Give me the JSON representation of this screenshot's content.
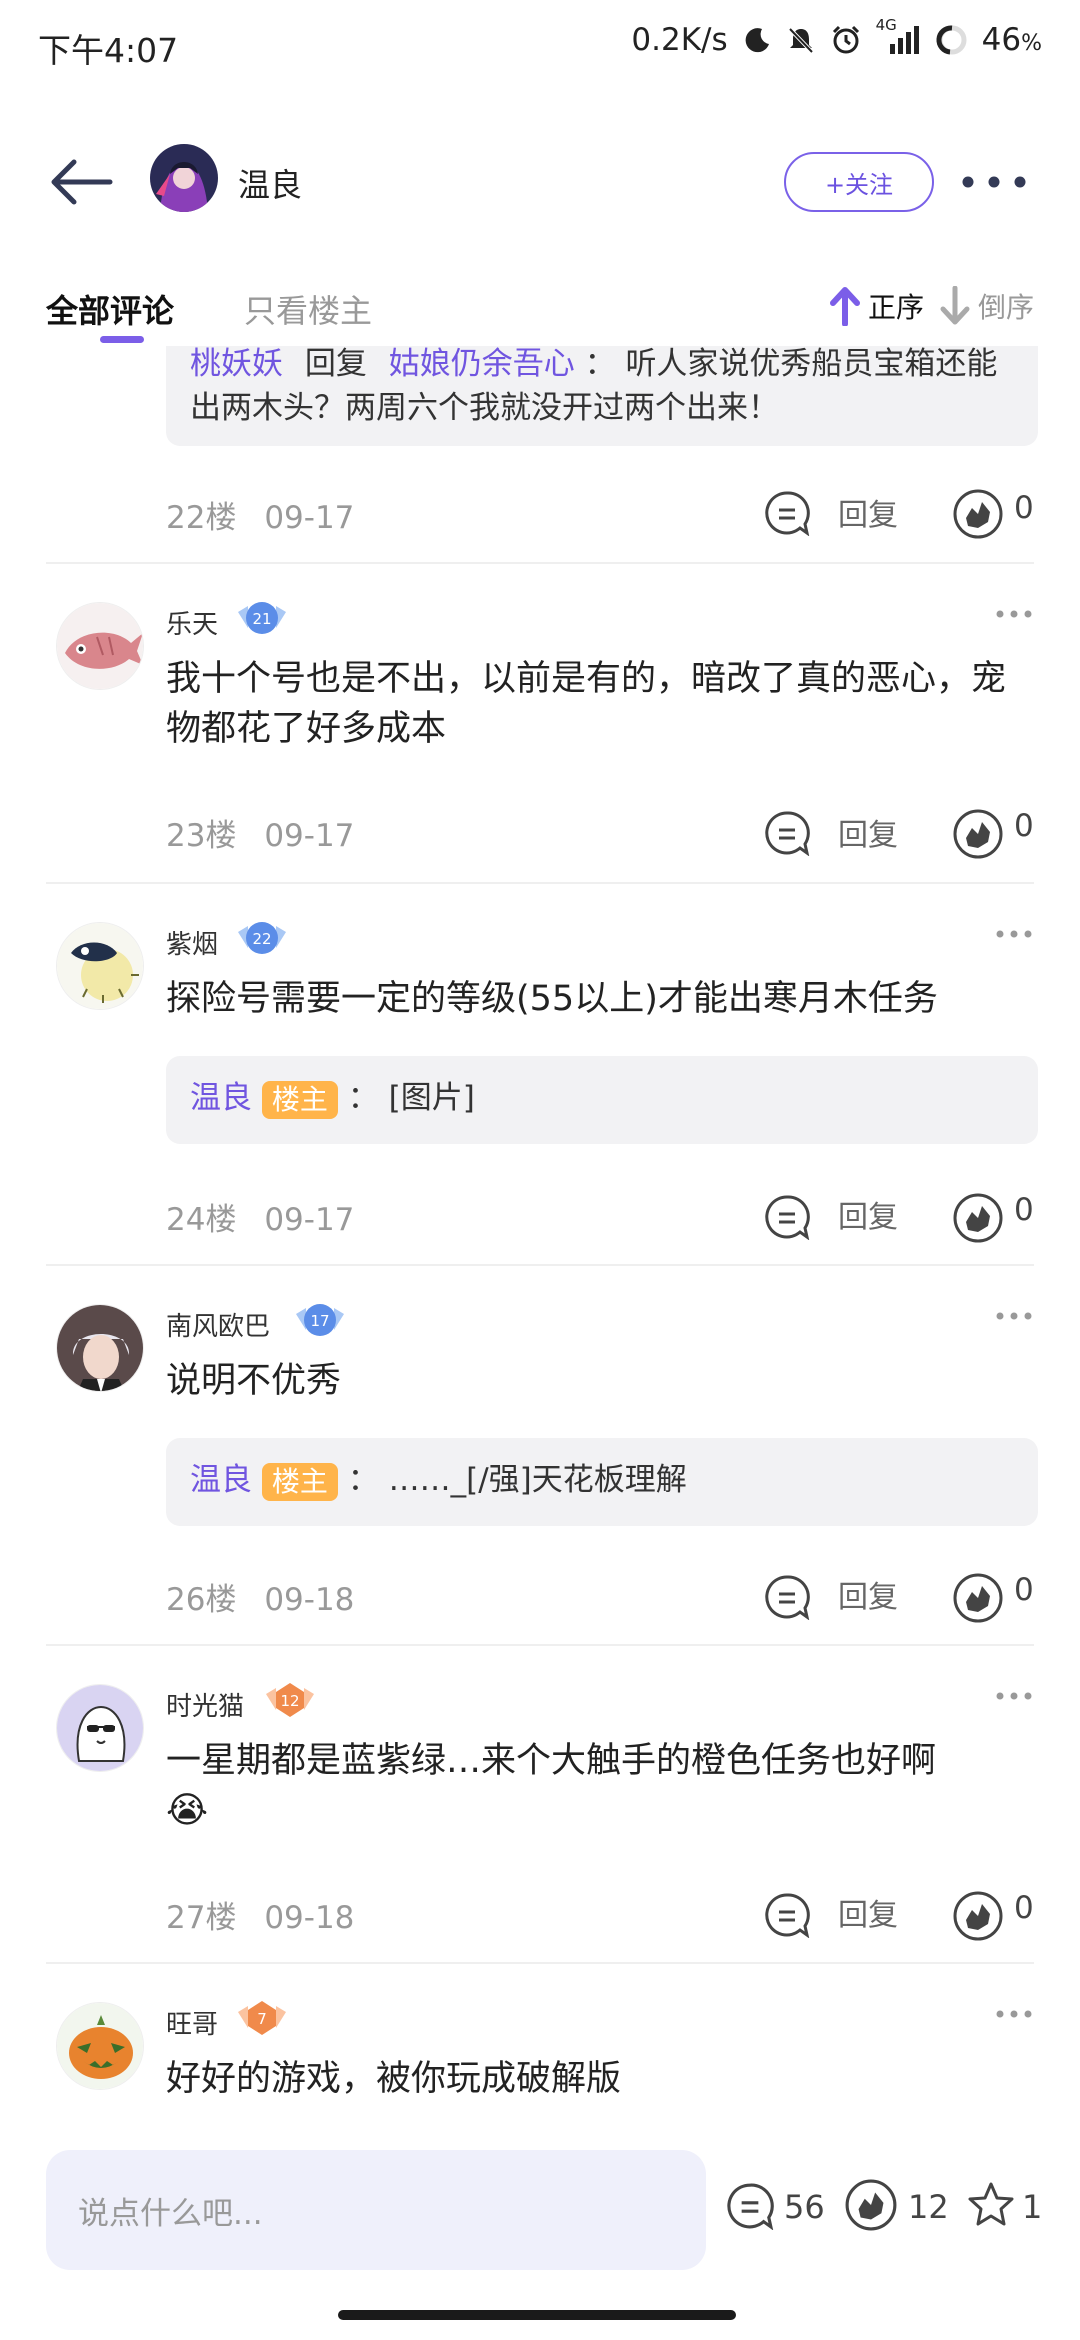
{
  "status_bar": {
    "time": "下午4:07",
    "speed": "0.2K/s",
    "network": "4G",
    "battery": "46"
  },
  "header": {
    "author_name": "温良",
    "follow_label": "+关注"
  },
  "tabs": {
    "all": "全部评论",
    "owner_only": "只看楼主",
    "sort_asc": "正序",
    "sort_desc": "倒序"
  },
  "thread": {
    "top_quote": {
      "user": "桃妖妖",
      "reply_word": "回复",
      "target": "姑娘仍余吾心",
      "text": "听人家说优秀船员宝箱还能出两木头？两周六个我就没开过两个出来！"
    },
    "top_meta": {
      "floor": "22楼",
      "date": "09-17",
      "reply_label": "回复",
      "likes": "0"
    },
    "comments": [
      {
        "user": "乐天",
        "level": "21",
        "text": "我十个号也是不出，以前是有的，暗改了真的恶心，宠物都花了好多成本",
        "floor": "23楼",
        "date": "09-17",
        "reply_label": "回复",
        "likes": "0"
      },
      {
        "user": "紫烟",
        "level": "22",
        "text": "探险号需要一定的等级(55以上)才能出寒月木任务",
        "quote": {
          "user": "温良",
          "tag": "楼主",
          "sep": "：",
          "text": "[图片]"
        },
        "floor": "24楼",
        "date": "09-17",
        "reply_label": "回复",
        "likes": "0"
      },
      {
        "user": "南风欧巴",
        "level": "17",
        "text": "说明不优秀",
        "quote": {
          "user": "温良",
          "tag": "楼主",
          "sep": "：",
          "text": "……_[/强]天花板理解"
        },
        "floor": "26楼",
        "date": "09-18",
        "reply_label": "回复",
        "likes": "0"
      },
      {
        "user": "时光猫",
        "level": "12",
        "text": "一星期都是蓝紫绿…来个大触手的橙色任务也好啊",
        "emoji": "😭",
        "floor": "27楼",
        "date": "09-18",
        "reply_label": "回复",
        "likes": "0"
      },
      {
        "user": "旺哥",
        "level": "7",
        "text": "好好的游戏，被你玩成破解版"
      }
    ]
  },
  "bottom_bar": {
    "placeholder": "说点什么吧...",
    "comment_count": "56",
    "like_count": "12",
    "star_count": "1"
  },
  "colors": {
    "accent": "#7b5ee8",
    "owner_tag": "#ffb44a",
    "level_blue": "#5b8de8",
    "level_orange": "#f08a4b"
  }
}
